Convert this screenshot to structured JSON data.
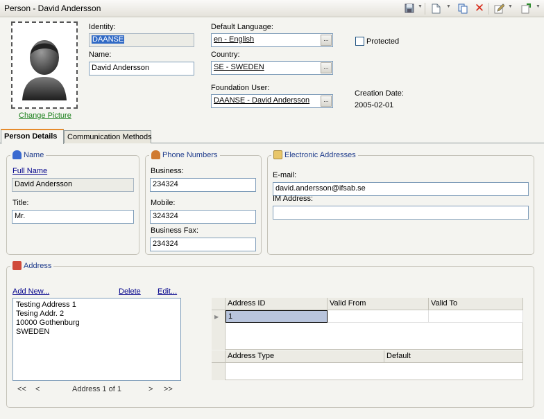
{
  "window": {
    "title": "Person - David Andersson"
  },
  "toolbar": {
    "save_icon": "save-icon",
    "new_icon": "new-document-icon",
    "copy_icon": "copy-icon",
    "delete_icon": "delete-icon",
    "edit_icon": "edit-icon",
    "attach_icon": "attachment-icon",
    "delete_color": "#d62a1a"
  },
  "header": {
    "change_picture": "Change Picture",
    "identity": {
      "label": "Identity:",
      "value": "DAANSE"
    },
    "name": {
      "label": "Name:",
      "value": "David Andersson"
    },
    "default_language": {
      "label": "Default Language:",
      "value": "en - English"
    },
    "country": {
      "label": "Country:",
      "value": "SE - SWEDEN"
    },
    "foundation_user": {
      "label": "Foundation User:",
      "value": "DAANSE - David Andersson"
    },
    "protected": {
      "label": "Protected",
      "checked": false
    },
    "creation_date": {
      "label": "Creation Date:",
      "value": "2005-02-01"
    },
    "lov_button": "..."
  },
  "tabs": [
    {
      "label": "Person Details",
      "active": true
    },
    {
      "label": "Communication Methods",
      "active": false
    }
  ],
  "name_group": {
    "title": "Name",
    "full_name_link": "Full Name",
    "full_name_value": "David Andersson",
    "title_label": "Title:",
    "title_value": "Mr."
  },
  "phone_group": {
    "title": "Phone Numbers",
    "business_label": "Business:",
    "business_value": "234324",
    "mobile_label": "Mobile:",
    "mobile_value": "324324",
    "fax_label": "Business Fax:",
    "fax_value": "234324"
  },
  "electronic_group": {
    "title": "Electronic Addresses",
    "email_label": "E-mail:",
    "email_value": "david.andersson@ifsab.se",
    "im_label": "IM Address:",
    "im_value": ""
  },
  "address_group": {
    "title": "Address",
    "add_new": "Add New...",
    "delete": "Delete",
    "edit": "Edit...",
    "lines": [
      "Testing Address 1",
      "Tesing Addr. 2",
      "10000 Gothenburg",
      "SWEDEN"
    ],
    "nav": {
      "first": "<<",
      "prev": "<",
      "status": "Address 1 of 1",
      "next": ">",
      "last": ">>"
    },
    "id_grid": {
      "columns": [
        "Address ID",
        "Valid From",
        "Valid To"
      ],
      "rows": [
        [
          "1",
          "",
          ""
        ]
      ]
    },
    "type_grid": {
      "columns": [
        "Address Type",
        "Default"
      ]
    }
  }
}
